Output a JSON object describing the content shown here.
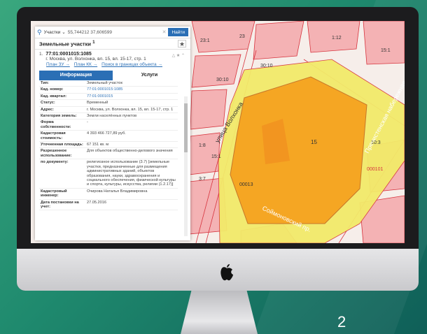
{
  "search": {
    "type_label": "Участки",
    "value": "55,744212 37,606599",
    "button": "Найти"
  },
  "panel": {
    "title": "Земельные участки",
    "title_sup": "1"
  },
  "result": {
    "number": "1.",
    "cad_id": "77:01:0001015:1085",
    "address": "г. Москва, ул. Волхонка, вл. 15, вл. 15-17, стр. 1",
    "links": [
      "План ЗУ →",
      "План КК →",
      "Поиск в границах объекта →"
    ]
  },
  "tabs": [
    "Информация",
    "Услуги"
  ],
  "info": [
    {
      "k": "Тип:",
      "v": "Земельный участок",
      "link": false
    },
    {
      "k": "Кад. номер:",
      "v": "77:01:0001015:1085",
      "link": true
    },
    {
      "k": "Кад. квартал:",
      "v": "77:01:0001015",
      "link": true
    },
    {
      "k": "Статус:",
      "v": "Временный",
      "link": false
    },
    {
      "k": "Адрес:",
      "v": "г. Москва, ул. Волхонка, вл. 15, вл. 15-17, стр. 1",
      "link": false
    },
    {
      "k": "Категория земель:",
      "v": "Земли населённых пунктов",
      "link": false
    },
    {
      "k": "Форма собственности:",
      "v": "-",
      "link": false
    },
    {
      "k": "Кадастровая стоимость:",
      "v": "4 393 466 727,89 руб.",
      "link": false
    },
    {
      "k": "Уточненная площадь:",
      "v": "67 151 кв. м",
      "link": false
    },
    {
      "k": "Разрешенное использование:",
      "v": "Для объектов общественно-делового значения",
      "link": false
    },
    {
      "k": "по документу:",
      "v": "религиозное использование (3.7) [земельные участки, предназначенные для размещения административных зданий, объектов образования, науки, здравоохранения и социального обеспечения, физической культуры и спорта, культуры, искусства, религии (1.2.17)]",
      "link": false
    },
    {
      "k": "Кадастровый инженер:",
      "v": "Очирова Наталья Владимировна",
      "link": false
    },
    {
      "k": "Дата постановки на учет:",
      "v": "27.05.2016",
      "link": false
    }
  ],
  "map_labels": {
    "street1": "улица Волхонка",
    "street2": "Пречистенская набережная",
    "street3": "Соймоновский пр.",
    "parcel": "15",
    "n1": "30:10",
    "n2": "30:10",
    "n3": "23",
    "n4": "23:1",
    "n5": "1:12",
    "n6": "10:3",
    "n7": "00013",
    "n8": "3:7",
    "n9": "1:8",
    "n10": "15:1",
    "n11": "15:1",
    "n12": "000101"
  },
  "page_number": "2",
  "colors": {
    "accent": "#2b6fb5",
    "parcel_fill": "#f5a623",
    "zone_fill": "#f2ea6a",
    "block_fill": "#f4b2b4",
    "boundary": "#d7343e"
  }
}
